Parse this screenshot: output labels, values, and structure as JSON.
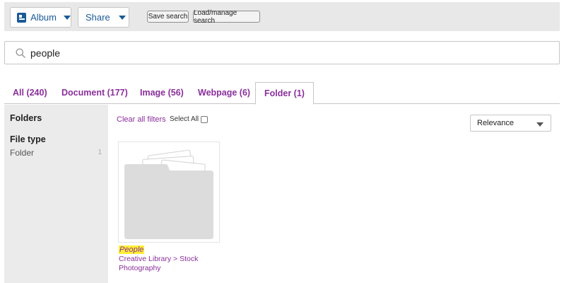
{
  "toolbar": {
    "album_label": "Album",
    "share_label": "Share",
    "save_search_label": "Save search",
    "load_search_label": "Load/manage search"
  },
  "search": {
    "value": "people",
    "icon": "search-icon"
  },
  "tabs": [
    {
      "label": "All (240)",
      "active": false
    },
    {
      "label": "Document (177)",
      "active": false
    },
    {
      "label": "Image (56)",
      "active": false
    },
    {
      "label": "Webpage (6)",
      "active": false
    },
    {
      "label": "Folder (1)",
      "active": true
    }
  ],
  "sidebar": {
    "folders_title": "Folders",
    "file_type_title": "File type",
    "items": [
      {
        "label": "Folder",
        "count": "1"
      }
    ]
  },
  "filters": {
    "clear_all": "Clear all filters",
    "select_all": "Select All"
  },
  "sort": {
    "selected": "Relevance"
  },
  "results": [
    {
      "title": "People",
      "path": "Creative Library > Stock Photography",
      "icon": "folder-icon"
    }
  ],
  "colors": {
    "accent": "#8a2f9b",
    "brand_blue": "#1a5a96",
    "highlight": "#ffee35"
  }
}
